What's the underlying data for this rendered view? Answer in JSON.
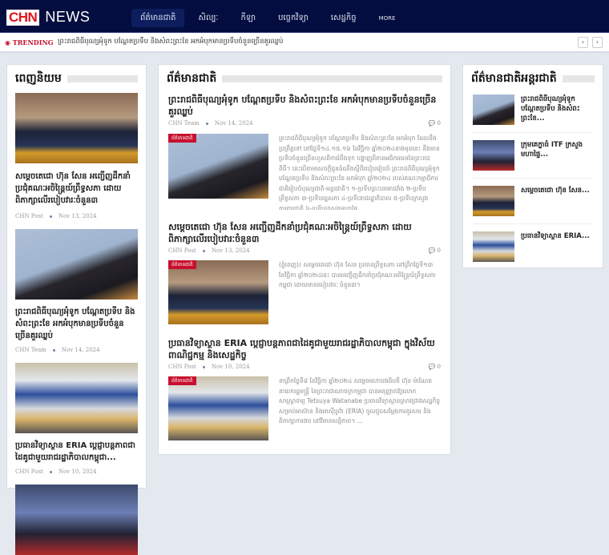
{
  "header": {
    "logo_red": "CHN",
    "logo_white": "NEWS",
    "nav": [
      {
        "label": "ព័ត៌មានជាតិ"
      },
      {
        "label": "សិល្បៈ"
      },
      {
        "label": "កីឡា"
      },
      {
        "label": "បច្ចេកវិទ្យា"
      },
      {
        "label": "សេដ្ឋកិច្ច"
      },
      {
        "label": "MORE"
      }
    ]
  },
  "trending": {
    "label": "TRENDING",
    "text": "ព្រះរាជពិធីបុណ្យអុំទូក បណ្តែតប្រទីប និងសំពះព្រះខែ អកអំបុកមានប្រទីបចំនួនច្រើនគួរឈ្លប់",
    "prev": "‹",
    "next": "›"
  },
  "popular": {
    "title": "ពេញនិយម",
    "items": [
      {
        "title": "សម្តេចតេជោ ហ៊ុន សែន អញ្ជើញដឹកនាំប្រជុំគណៈអចិន្ត្រៃយ៍ព្រឹទ្ធសភា ដោយពិភាក្សាលើរបៀបវារៈចំនួន៣",
        "author": "CHN Post",
        "date": "Nov 13, 2024"
      },
      {
        "title": "ព្រះរាជពិធីបុណ្យអុំទូក បណ្តែតប្រទីប និងសំពះព្រះខែ អកអំបុកមានប្រទីបចំនួនច្រើនគួរឈ្លប់",
        "author": "CHN Team",
        "date": "Nov 14, 2024"
      },
      {
        "title": "ប្រធានវិទ្យាស្ថាន ERIA ប្តេជ្ញាបន្តភាពជាដៃគូជាមួយរាជរដ្ឋាភិបាលកម្ពុជា...",
        "author": "CHN Post",
        "date": "Nov 10, 2024"
      }
    ]
  },
  "national": {
    "title": "ព័ត៌មានជាតិ",
    "tag": "ព័ត៌មានជាតិ",
    "articles": [
      {
        "title": "ព្រះរាជពិធីបុណ្យអុំទូក បណ្តែតប្រទីប និងសំពះព្រះខែ អកអំបុកមានប្រទីបចំនួនច្រើនគួរឈ្លប់",
        "author": "CHN Team",
        "date": "Nov 14, 2024",
        "comments": "0",
        "excerpt": "ព្រះរាជពិធីបុណ្យអុំទូក បណ្តែតប្រទីប និងសំពះព្រះខែ អកអំបុក ដែលនឹងប្រព្រឹត្តទៅ នៅថ្ងៃទី១៤.១៥.១៦ ខែវិច្ឆិកា ឆ្នាំ២០២៤ខាងមុខនេះ នឹងមានប្រទីបចំនួនច្រើនហួសពីការរំពឹងទុក បង្ហាញពីភាពអធិកអធមនៃព្រះរាជពិធី។ នេះបើតាមសេចក្តីជូនដំណឹងស្តីពីរបៀបរៀបចំ ព្រះរាជពិធីបុណ្យអុំទូក បណ្តែតប្រទីប និងសំពះព្រះខែ អកអំបុក ឆ្នាំ២០២៤ របស់គណៈកម្មាធិការជាតិរៀបចំបុណ្យជាតិ-អន្តរជាតិ។ ១-ប្រទីបព្រះបរមរាជវាំង ២-ប្រទីបព្រឹទ្ធសភា ៣-ប្រទីបរដ្ឋសភា ៤-ប្រទីបរាជរដ្ឋាភិបាល ៥-ប្រទីបក្រសួងការពារជាតិ ៦-ប្រទីបក្រសួងមហាផ្ទៃ..."
      },
      {
        "title": "សម្តេចតេជោ ហ៊ុន សែន អញ្ជើញដឹកនាំប្រជុំគណៈអចិន្ត្រៃយ៍ព្រឹទ្ធសភា ដោយពិភាក្សាលើរបៀបវារៈចំនួន៣",
        "author": "CHN Post",
        "date": "Nov 13, 2024",
        "comments": "0",
        "excerpt": "(ភ្នំពេញ)៖ សម្តេចតេជោ ហ៊ុន សែន ប្រធានព្រឹទ្ធសភា នៅព្រឹកថ្ងៃទី១៣ ខែវិច្ឆិកា ឆ្នាំ២០២៤នេះ បានអញ្ជើញដឹកនាំប្រជុំគណៈអចិន្ត្រៃយ៍ព្រឹទ្ធសភាកម្ពុជា ដោយមានរបៀបវារៈ ចំនួន៣។"
      },
      {
        "title": "ប្រធានវិទ្យាស្ថាន ERIA ប្តេជ្ញាបន្តភាពជាដៃគូជាមួយរាជរដ្ឋាភិបាលកម្ពុជា ក្នុងវិស័យពាណិជ្ជកម្ម និងសេដ្ឋកិច្ច",
        "author": "CHN Post",
        "date": "Nov 10, 2024",
        "comments": "0",
        "excerpt": "នាព្រឹកថ្ងៃទី៨ ខែវិច្ឆិកា ឆ្នាំ២០២៤ សម្តេចមហាបវរធិបតី ហ៊ុន ម៉ាណែត នាយករដ្ឋមន្ត្រី នៃព្រះរាជាណាចក្រកម្ពុជា បានអនុញ្ញាតឱ្យលោកសាស្ត្រាចារ្យ Tetsuya Watanabe ប្រធានវិទ្យាស្ថានស្រាវជ្រាវសេដ្ឋកិច្ចសម្រាប់អាស៊ាន និងអាស៊ីបូព៌ា (ERIA) ចូលជួបសម្តែងការគួរសម និងពិភាក្សាការងារ នៅវិមានសន្តិភាព។ ..."
      }
    ]
  },
  "international": {
    "title": "ព័ត៌មានជាតិអន្តរជាតិ",
    "items": [
      {
        "title": "ព្រះរាជពិធីបុណ្យអុំទូក បណ្តែតប្រទីប និងសំពះព្រះខែ..."
      },
      {
        "title": "ក្រុមគេក្ខាធំ ITF ក្រសួងមហាផ្ទៃ..."
      },
      {
        "title": "សម្តេចតេជោ ហ៊ុន សែន..."
      },
      {
        "title": "ប្រធានវិទ្យាស្ថាន ERIA..."
      }
    ]
  }
}
